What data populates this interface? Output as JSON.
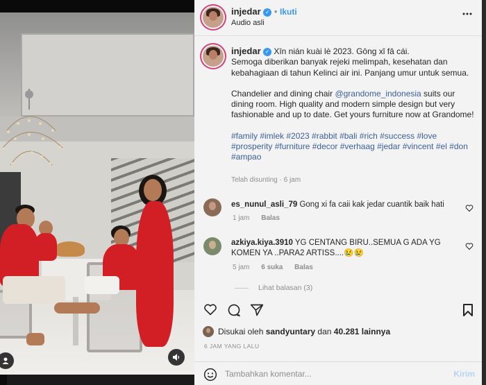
{
  "post": {
    "author": "injedar",
    "follow_label": "Ikuti",
    "audio_label": "Audio asli",
    "more_icon": "more-horizontal-icon"
  },
  "caption": {
    "author": "injedar",
    "line1": "Xīn nián kuài lè 2023. Gōng xǐ fā cái.",
    "line2": "Semoga diberikan banyak rejeki melimpah, kesehatan dan kebahagiaan di tahun Kelinci air ini. Panjang umur untuk semua.",
    "para2_before": "Chandelier and dining chair ",
    "mention": "@grandome_indonesia",
    "para2_after": " suits our dining room. High quality and modern simple design but very fashionable and up to date. Get yours furniture now at Grandome!",
    "hashtags": "#family #imlek #2023 #rabbit #bali #rich #success #love #prosperity #furniture #decor #verhaag #jedar #vincent #el #don #ampao",
    "edited": "Telah disunting · 6 jam"
  },
  "comments": [
    {
      "user": "es_nunul_asli_79",
      "text": "Gong xi fa caii kak jedar cuantik baik hati",
      "time": "1 jam",
      "reply_label": "Balas"
    },
    {
      "user": "azkiya.kiya.3910",
      "text": "YG CENTANG BIRU..SEMUA G ADA YG KOMEN YA ..PARA2 ARTISS....😢😢",
      "time": "5 jam",
      "likes": "6 suka",
      "reply_label": "Balas",
      "view_replies": "Lihat balasan (3)"
    }
  ],
  "likes": {
    "prefix": "Disukai oleh ",
    "user": "sandyuntary",
    "middle": " dan ",
    "count": "40.281 lainnya"
  },
  "date": "6 JAM YANG LALU",
  "composer": {
    "placeholder": "Tambahkan komentar...",
    "post_label": "Kirim"
  }
}
